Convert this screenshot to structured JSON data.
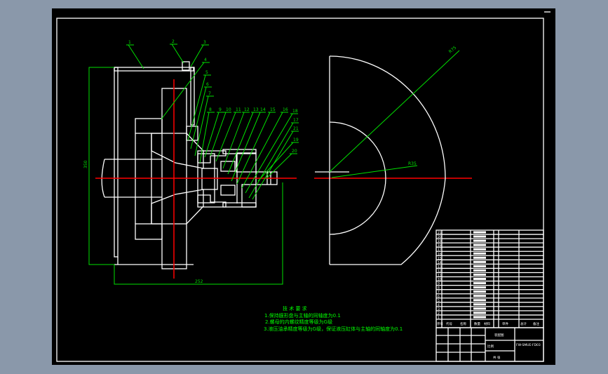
{
  "drawing": {
    "part_labels": [
      "1",
      "2",
      "3",
      "4",
      "5",
      "6",
      "7",
      "8",
      "9",
      "10",
      "11",
      "12",
      "13",
      "14",
      "15",
      "16",
      "18",
      "17",
      "21",
      "19",
      "20"
    ],
    "dimensions": {
      "height": "350",
      "width": "252",
      "outer_radius": "R75",
      "inner_radius": "R35"
    },
    "tech_requirements": {
      "title": "技 术 要 求",
      "items": [
        "1.保持膜形盘与主轴的同轴度为0.1",
        "2.螺母的内螺纹精度等级为G级",
        "3.液压油承精度等级为G级，保证液压缸体与主轴的同轴度为0.1"
      ]
    },
    "parts_list": {
      "row_numbers": [
        "21",
        "20",
        "19",
        "18",
        "17",
        "16",
        "15",
        "14",
        "13",
        "12",
        "11",
        "10",
        "9",
        "8",
        "7",
        "6",
        "5",
        "4",
        "3",
        "2",
        "1"
      ],
      "header": [
        "序号",
        "代号",
        "名称",
        "数量",
        "材料",
        "单件",
        "总计",
        "备注"
      ]
    },
    "title_block": {
      "name": "装配图",
      "drawing_no": "FW-SMUE-FD03",
      "scale_label": "比例",
      "sheet_label": "共 张"
    }
  },
  "colors": {
    "background": "#8a98aa",
    "sheet": "#000000",
    "lines": "#ffffff",
    "annotation": "#00e000",
    "centerline": "#ff0000"
  }
}
